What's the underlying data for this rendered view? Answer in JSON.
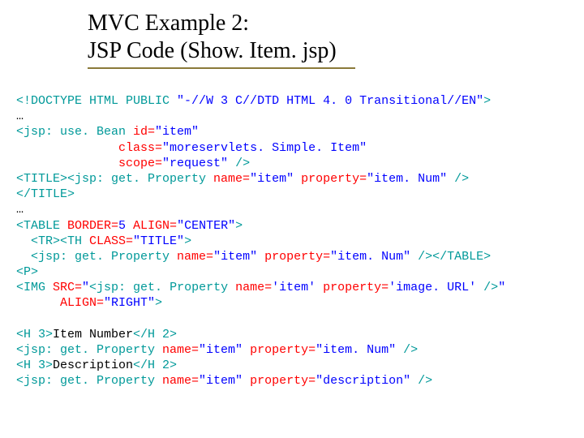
{
  "title": {
    "line1": "MVC Example 2:",
    "line2": "JSP Code (Show. Item. jsp)"
  },
  "code": {
    "doctype_open": "<!DOCTYPE HTML PUBLIC ",
    "doctype_val": "\"-//W 3 C//DTD HTML 4. 0 Transitional//EN\"",
    "doctype_close": ">",
    "ellipsis": "…",
    "usebean_open": "<jsp: use. Bean ",
    "id_n": "id=",
    "id_v": "\"item\"",
    "class_n": "class=",
    "class_v": "\"moreservlets. Simple. Item\"",
    "scope_n": "scope=",
    "scope_v": "\"request\"",
    "selfclose": " />",
    "title_open": "<TITLE>",
    "getprop_open": "<jsp: get. Property ",
    "name_n": "name=",
    "name_v": "\"item\"",
    "name_v_sq": "'item'",
    "prop_n": "property=",
    "prop_itemnum": "\"item. Num\"",
    "prop_imageurl_sq": "'image. URL'",
    "prop_desc": "\"description\"",
    "title_close": "</TITLE>",
    "table_open": "<TABLE ",
    "border_n": "BORDER=",
    "border_v": "5",
    "align_n": " ALIGN=",
    "align_center": "\"CENTER\"",
    "align_right": "\"RIGHT\"",
    "gt": ">",
    "tr_open": "  <TR>",
    "th_open": "<TH ",
    "thclass_n": "CLASS=",
    "thclass_v": "\"TITLE\"",
    "table_close": "</TABLE>",
    "p_open": "<P>",
    "img_open": "<IMG ",
    "src_n": "SRC=",
    "src_prefix": "\"",
    "src_suffix": "\"",
    "indent": "     ",
    "h3_open": "<H 3>",
    "h2_close": "</H 2>",
    "label_itemnum": "Item Number",
    "label_desc": "Description",
    "pad14": "              ",
    "pad2": "  "
  }
}
